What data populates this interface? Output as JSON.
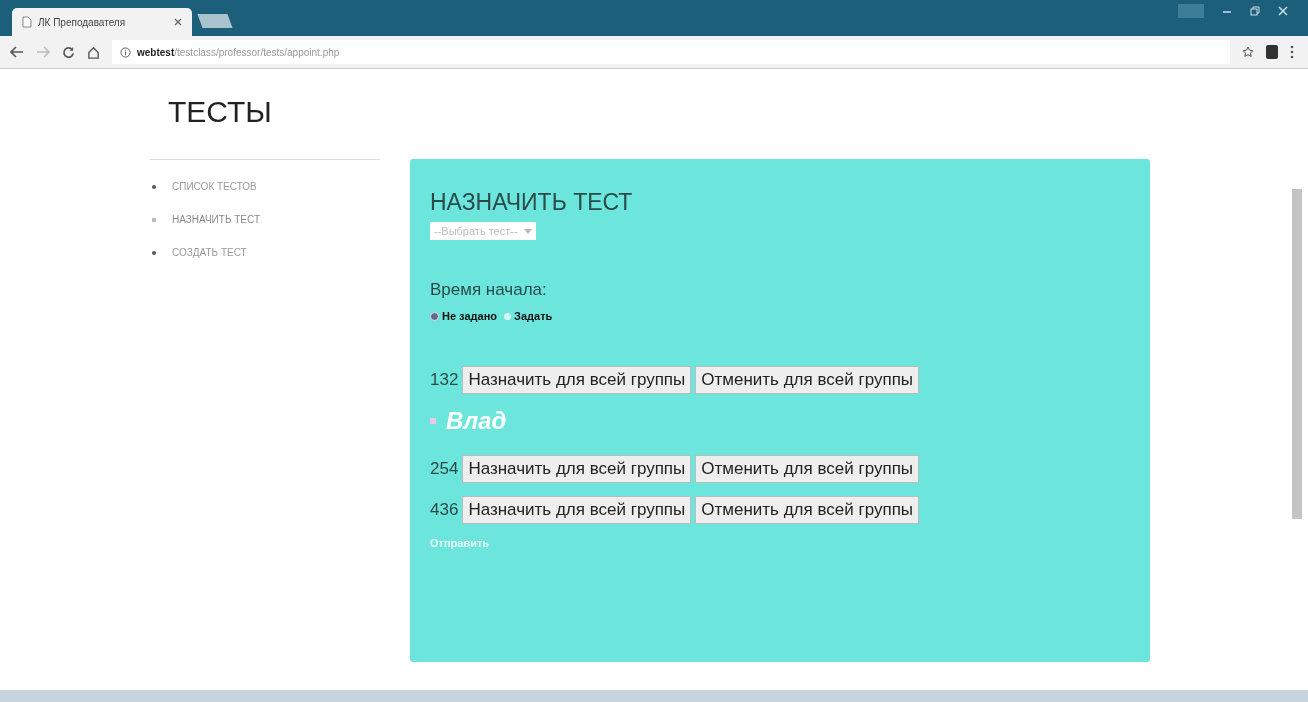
{
  "browser": {
    "tab_title": "ЛК Преподавателя",
    "url_host": "webtest",
    "url_path": "/testclass/professor/tests/appoint.php"
  },
  "page_title": "ТЕСТЫ",
  "sidebar": {
    "items": [
      {
        "label": "СПИСОК ТЕСТОВ",
        "selected": false
      },
      {
        "label": "НАЗНАЧИТЬ ТЕСТ",
        "selected": true
      },
      {
        "label": "СОЗДАТЬ ТЕСТ",
        "selected": false
      }
    ]
  },
  "form": {
    "heading": "НАЗНАЧИТЬ ТЕСТ",
    "test_select": {
      "value": "--Выбрать тест--"
    },
    "start_label": "Время начала:",
    "start_options": [
      {
        "label": "Не задано",
        "selected": true
      },
      {
        "label": "Задать",
        "selected": false
      }
    ],
    "entries": [
      {
        "kind": "group",
        "number": "132",
        "assign": "Назначить для всей группы",
        "cancel": "Отменить для всей группы"
      },
      {
        "kind": "student",
        "name": "Влад"
      },
      {
        "kind": "group",
        "number": "254",
        "assign": "Назначить для всей группы",
        "cancel": "Отменить для всей группы"
      },
      {
        "kind": "group",
        "number": "436",
        "assign": "Назначить для всей группы",
        "cancel": "Отменить для всей группы"
      }
    ],
    "submit": "Отправить"
  }
}
